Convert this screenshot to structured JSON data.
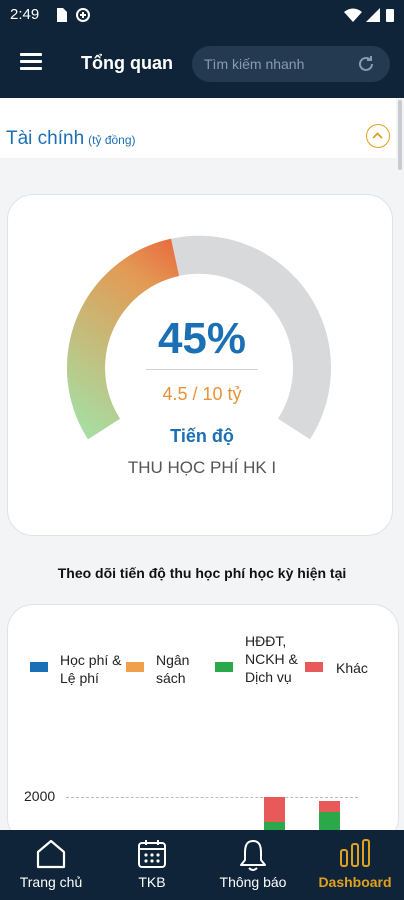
{
  "status_bar": {
    "time": "2:49"
  },
  "header": {
    "title": "Tổng quan",
    "search_placeholder": "Tìm kiếm nhanh"
  },
  "finance": {
    "section_title": "Tài chính",
    "unit": "(tỷ đồng)"
  },
  "progress_card": {
    "percent_text": "45%",
    "progress_fraction": 0.45,
    "amount_text": "4.5 / 10 tỷ",
    "progress_label": "Tiến độ",
    "fee_label": "THU HỌC PHÍ HK I"
  },
  "tracking_title": "Theo dõi tiến độ thu học phí học kỳ hiện tại",
  "chart_data": {
    "type": "bar",
    "legend_position": "top",
    "series": [
      {
        "name": "Học phí & Lệ phí",
        "color": "#1b6fb5"
      },
      {
        "name": "Ngân sách",
        "color": "#f0a04b"
      },
      {
        "name": "HĐĐT, NCKH & Dịch vụ",
        "color": "#2aa84a"
      },
      {
        "name": "Khác",
        "color": "#e85a5a"
      }
    ],
    "y_ticks": [
      "2000"
    ]
  },
  "bottom_nav": {
    "items": [
      {
        "label": "Trang chủ"
      },
      {
        "label": "TKB"
      },
      {
        "label": "Thông báo"
      },
      {
        "label": "Dashboard"
      }
    ],
    "active_color": "#e0a020"
  }
}
